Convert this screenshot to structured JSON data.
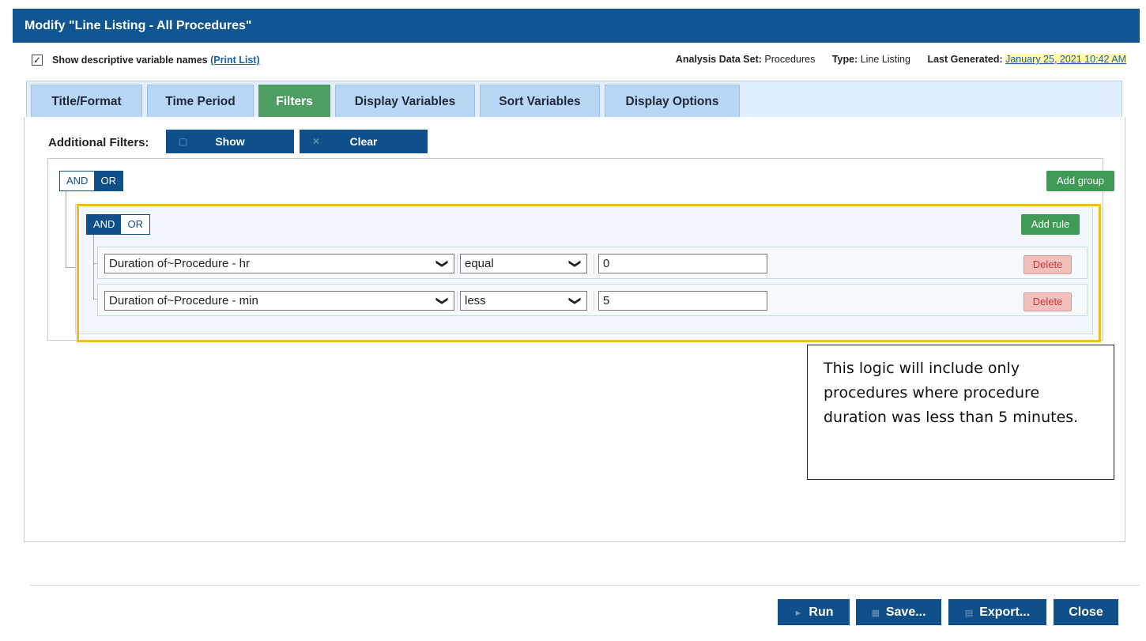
{
  "window": {
    "title": "Modify \"Line Listing - All Procedures\""
  },
  "meta": {
    "checkbox_label": "Show descriptive variable names",
    "print_link": "(Print List)",
    "checked": true,
    "analysis_label": "Analysis Data Set:",
    "analysis_value": "Procedures",
    "type_label": "Type:",
    "type_value": "Line Listing",
    "generated_label": "Last Generated:",
    "generated_value": "January 25, 2021 10:42 AM"
  },
  "tabs": [
    {
      "label": "Title/Format"
    },
    {
      "label": "Time Period"
    },
    {
      "label": "Filters",
      "active": true
    },
    {
      "label": "Display Variables"
    },
    {
      "label": "Sort Variables"
    },
    {
      "label": "Display Options"
    }
  ],
  "filters": {
    "label": "Additional Filters:",
    "show_label": "Show",
    "clear_label": "Clear",
    "outer_group": {
      "and_label": "AND",
      "or_label": "OR",
      "selected": "OR",
      "add_group_label": "Add group"
    },
    "inner_group": {
      "and_label": "AND",
      "or_label": "OR",
      "selected": "AND",
      "add_rule_label": "Add rule",
      "rules": [
        {
          "variable": "Duration of~Procedure - hr",
          "operator": "equal",
          "value": "0",
          "delete_label": "Delete"
        },
        {
          "variable": "Duration of~Procedure - min",
          "operator": "less",
          "value": "5",
          "delete_label": "Delete"
        }
      ]
    }
  },
  "callout": "This logic will include only procedures where procedure duration was less than 5 minutes.",
  "footer": {
    "run": "Run",
    "save": "Save...",
    "export": "Export...",
    "close": "Close"
  },
  "colors": {
    "title_bar": "#0f5592",
    "active_tab": "#4e9e63",
    "highlight_box": "#f5bc1d",
    "delete": "#f3bfbd"
  }
}
